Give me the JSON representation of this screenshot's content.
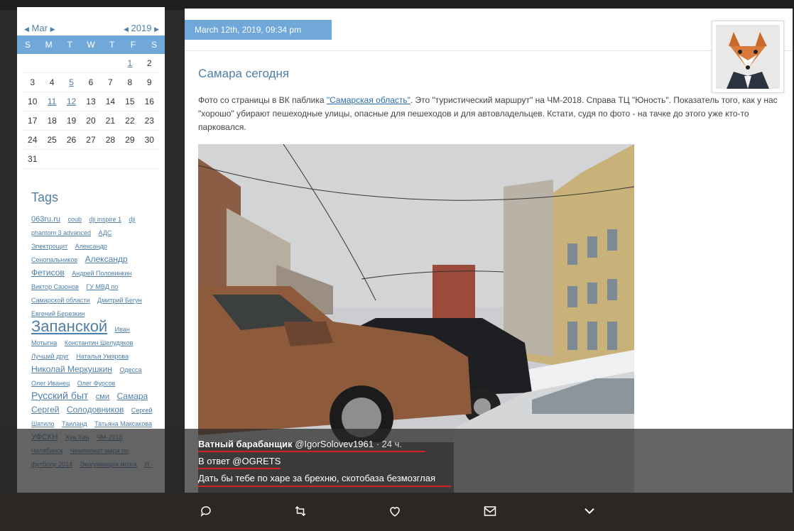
{
  "calendar": {
    "month": "Mar",
    "year": "2019",
    "weekdays": [
      "S",
      "M",
      "T",
      "W",
      "T",
      "F",
      "S"
    ],
    "weeks": [
      [
        "",
        "",
        "",
        "",
        "",
        "1",
        "2"
      ],
      [
        "3",
        "4",
        "5",
        "6",
        "7",
        "8",
        "9"
      ],
      [
        "10",
        "11",
        "12",
        "13",
        "14",
        "15",
        "16"
      ],
      [
        "17",
        "18",
        "19",
        "20",
        "21",
        "22",
        "23"
      ],
      [
        "24",
        "25",
        "26",
        "27",
        "28",
        "29",
        "30"
      ],
      [
        "31",
        "",
        "",
        "",
        "",
        "",
        ""
      ]
    ],
    "linked_days": [
      "1",
      "5",
      "11",
      "12"
    ]
  },
  "tags": {
    "title": "Tags",
    "items": [
      {
        "label": "063ru.ru",
        "size": "t11"
      },
      {
        "label": "coub",
        "size": "t9"
      },
      {
        "label": "dji inspire 1",
        "size": "t9"
      },
      {
        "label": "dji",
        "size": "t9"
      },
      {
        "label": "phantom 3 advanced",
        "size": "t9"
      },
      {
        "label": "АДС",
        "size": "t9"
      },
      {
        "label": "Электрощит",
        "size": "t9"
      },
      {
        "label": "Александр",
        "size": "t9"
      },
      {
        "label": "Сенопальников",
        "size": "t9"
      },
      {
        "label": "Александр",
        "size": "t12"
      },
      {
        "label": "Фетисов",
        "size": "t12"
      },
      {
        "label": "Андрей Половинкин",
        "size": "t9"
      },
      {
        "label": "Виктор Сазонов",
        "size": "t9"
      },
      {
        "label": "ГУ МВД по",
        "size": "t9"
      },
      {
        "label": "Самарской области",
        "size": "t9"
      },
      {
        "label": "Дмитрий Бегун",
        "size": "t9"
      },
      {
        "label": "Евгений Березкин",
        "size": "t9"
      },
      {
        "label": "Запанской",
        "size": "t22"
      },
      {
        "label": "Иван",
        "size": "t9"
      },
      {
        "label": "Мотыгна",
        "size": "t9"
      },
      {
        "label": "Константин Шелудяков",
        "size": "t9"
      },
      {
        "label": "Лучший друг",
        "size": "t9"
      },
      {
        "label": "Наталья Умярова",
        "size": "t9"
      },
      {
        "label": "Николай Меркушкин",
        "size": "t12"
      },
      {
        "label": "Одесса",
        "size": "t9"
      },
      {
        "label": "Олег Иванец",
        "size": "t9"
      },
      {
        "label": "Олег Фурсов",
        "size": "t9"
      },
      {
        "label": "Русский быт",
        "size": "t14"
      },
      {
        "label": "сми",
        "size": "t11"
      },
      {
        "label": "Самара",
        "size": "t12"
      },
      {
        "label": "Сергей",
        "size": "t12"
      },
      {
        "label": "Солодовников",
        "size": "t12"
      },
      {
        "label": "Сергей Шатило",
        "size": "t9"
      },
      {
        "label": "Таиланд",
        "size": "t9"
      },
      {
        "label": "Татьяна Максакова",
        "size": "t9"
      },
      {
        "label": "УФСКН",
        "size": "t11"
      },
      {
        "label": "Хуа Хин",
        "size": "t9"
      },
      {
        "label": "ЧМ-2018",
        "size": "t9"
      },
      {
        "label": "Челябинск",
        "size": "t9"
      },
      {
        "label": "Чемпионат мира по",
        "size": "t9"
      },
      {
        "label": "футболу 2014",
        "size": "t9"
      },
      {
        "label": "Экогуманция мозга",
        "size": "t9"
      },
      {
        "label": "Я -",
        "size": "t9"
      }
    ]
  },
  "post": {
    "date": "March 12th, 2019, 09:34 pm",
    "title": "Самара сегодня",
    "body_before_link": "Фото со страницы в ВК паблика ",
    "body_link": "\"Самарская область\"",
    "body_after_link": ". Это \"туристический маршрут\" на ЧМ-2018. Справа ТЦ \"Юность\". Показатель того, как у нас \"хорошо\" убирают пешеходные улицы, опасные для пешеходов и для автовладельцев. Кстати, судя по фото - на тачке до этого уже кто-то парковался."
  },
  "tweet": {
    "author": "Ватный барабанщик",
    "handle": "@IgorSolovev1961",
    "time": "· 24 ч.",
    "reply_to": "В ответ @OGRETS",
    "text": "Дать бы тебе по харе за брехню, скотобаза безмозглая"
  },
  "actions": [
    {
      "name": "reply-icon"
    },
    {
      "name": "retweet-icon"
    },
    {
      "name": "like-icon"
    },
    {
      "name": "message-icon"
    },
    {
      "name": "more-chevron-icon"
    }
  ],
  "colors": {
    "accent": "#6fa8d9",
    "link": "#4f7fa8",
    "underline_highlight": "#d32027"
  }
}
